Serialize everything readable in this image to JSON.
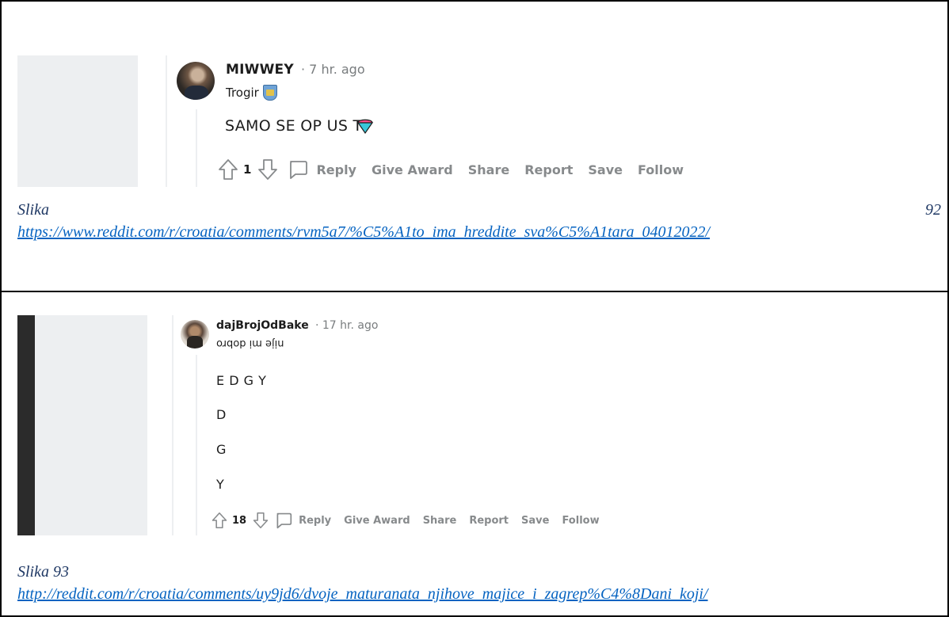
{
  "comment1": {
    "username": "MIWWEY",
    "meta": "· 7 hr. ago",
    "flair": "Trogir",
    "flair_icon": "city-coat-of-arms-icon",
    "body": "SAMO SE OP US TI",
    "body_icon": "ice-cream-award-icon",
    "votes": "1",
    "actions": {
      "reply": "Reply",
      "give_award": "Give Award",
      "share": "Share",
      "report": "Report",
      "save": "Save",
      "follow": "Follow"
    }
  },
  "caption1": {
    "label": "Slika",
    "number": "92",
    "url": "https://www.reddit.com/r/croatia/comments/rvm5a7/%C5%A1to_ima_hreddite_sva%C5%A1tara_04012022/"
  },
  "comment2": {
    "username": "dajBrojOdBake",
    "meta": "· 17 hr. ago",
    "flair": "nije mi dobro",
    "body_lines": [
      "E D G Y",
      "D",
      "G",
      "Y"
    ],
    "votes": "18",
    "actions": {
      "reply": "Reply",
      "give_award": "Give Award",
      "share": "Share",
      "report": "Report",
      "save": "Save",
      "follow": "Follow"
    }
  },
  "caption2": {
    "label": "Slika 93",
    "url": "http://reddit.com/r/croatia/comments/uy9jd6/dvoje_maturanata_njihove_majice_i_zagrep%C4%8Dani_koji/"
  },
  "colors": {
    "muted_text": "#878a8c",
    "panel_gray": "#edeff1",
    "caption_blue": "#1f3864",
    "link_blue": "#0563c1"
  }
}
